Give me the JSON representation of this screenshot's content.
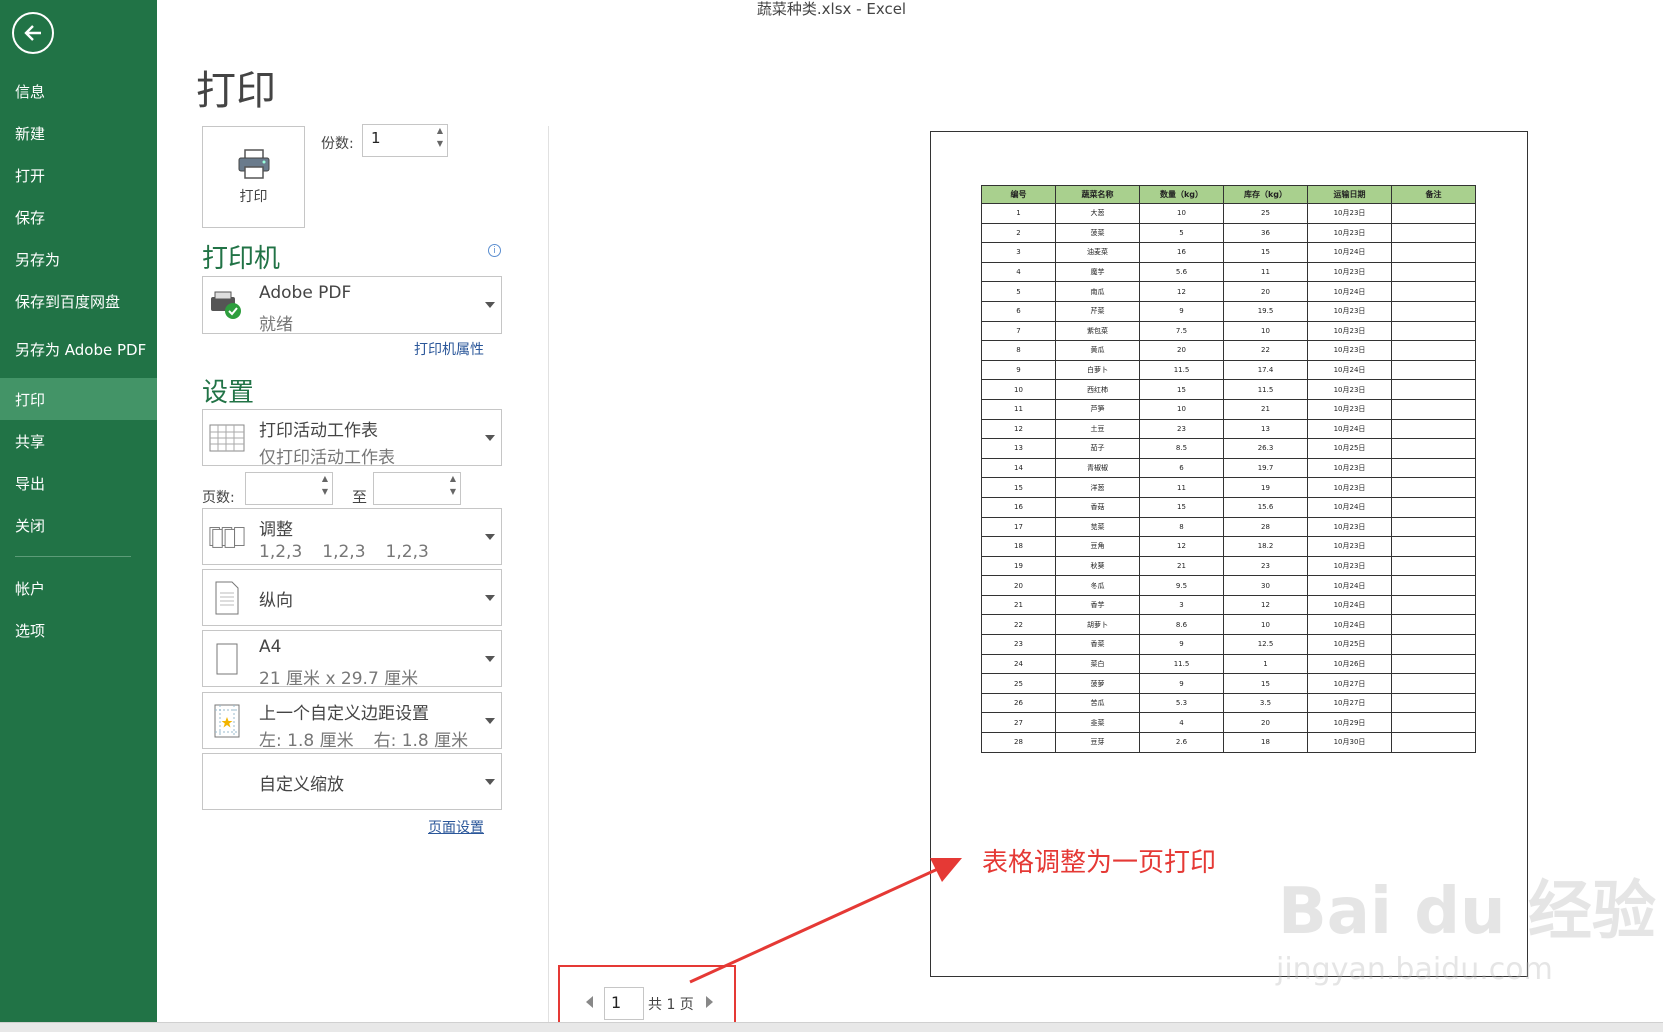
{
  "window_title": "蔬菜种类.xlsx - Excel",
  "sidebar": {
    "items": [
      {
        "label": "信息"
      },
      {
        "label": "新建"
      },
      {
        "label": "打开"
      },
      {
        "label": "保存"
      },
      {
        "label": "另存为"
      },
      {
        "label": "保存到百度网盘"
      },
      {
        "label": "另存为 Adobe PDF"
      },
      {
        "label": "打印",
        "active": true
      },
      {
        "label": "共享"
      },
      {
        "label": "导出"
      },
      {
        "label": "关闭"
      }
    ],
    "bottom_items": [
      {
        "label": "帐户"
      },
      {
        "label": "选项"
      }
    ]
  },
  "page_title": "打印",
  "print_button_label": "打印",
  "copies": {
    "label": "份数:",
    "value": "1"
  },
  "printer": {
    "heading": "打印机",
    "name": "Adobe PDF",
    "status": "就绪",
    "properties_link": "打印机属性"
  },
  "settings": {
    "heading": "设置",
    "scope": {
      "title": "打印活动工作表",
      "subtitle": "仅打印活动工作表"
    },
    "pages_label": "页数:",
    "to_label": "至",
    "collate": {
      "title": "调整",
      "subtitle_parts": [
        "1,2,3",
        "1,2,3",
        "1,2,3"
      ]
    },
    "orientation": {
      "title": "纵向"
    },
    "paper": {
      "title": "A4",
      "subtitle": "21 厘米 x 29.7 厘米"
    },
    "margins": {
      "title": "上一个自定义边距设置",
      "subtitle_left": "左:  1.8 厘米",
      "subtitle_right": "右:  1.8 厘米"
    },
    "scaling": {
      "title": "自定义缩放"
    },
    "page_setup_link": "页面设置"
  },
  "preview_table": {
    "headers": [
      "编号",
      "蔬菜名称",
      "数量（kg）",
      "库存（kg）",
      "运输日期",
      "备注"
    ],
    "rows": [
      [
        "1",
        "大葱",
        "10",
        "25",
        "10月23日",
        ""
      ],
      [
        "2",
        "菠菜",
        "5",
        "36",
        "10月23日",
        ""
      ],
      [
        "3",
        "油麦菜",
        "16",
        "15",
        "10月24日",
        ""
      ],
      [
        "4",
        "魔芋",
        "5.6",
        "11",
        "10月23日",
        ""
      ],
      [
        "5",
        "南瓜",
        "12",
        "20",
        "10月24日",
        ""
      ],
      [
        "6",
        "芹菜",
        "9",
        "19.5",
        "10月23日",
        ""
      ],
      [
        "7",
        "紫包菜",
        "7.5",
        "10",
        "10月23日",
        ""
      ],
      [
        "8",
        "黄瓜",
        "20",
        "22",
        "10月23日",
        ""
      ],
      [
        "9",
        "白萝卜",
        "11.5",
        "17.4",
        "10月24日",
        ""
      ],
      [
        "10",
        "西红柿",
        "15",
        "11.5",
        "10月23日",
        ""
      ],
      [
        "11",
        "芦笋",
        "10",
        "21",
        "10月23日",
        ""
      ],
      [
        "12",
        "土豆",
        "23",
        "13",
        "10月24日",
        ""
      ],
      [
        "13",
        "茄子",
        "8.5",
        "26.3",
        "10月25日",
        ""
      ],
      [
        "14",
        "青椒椒",
        "6",
        "19.7",
        "10月23日",
        ""
      ],
      [
        "15",
        "洋葱",
        "11",
        "19",
        "10月23日",
        ""
      ],
      [
        "16",
        "香菇",
        "15",
        "15.6",
        "10月24日",
        ""
      ],
      [
        "17",
        "苋菜",
        "8",
        "28",
        "10月23日",
        ""
      ],
      [
        "18",
        "豆角",
        "12",
        "18.2",
        "10月23日",
        ""
      ],
      [
        "19",
        "秋葵",
        "21",
        "23",
        "10月23日",
        ""
      ],
      [
        "20",
        "冬瓜",
        "9.5",
        "30",
        "10月24日",
        ""
      ],
      [
        "21",
        "香芋",
        "3",
        "12",
        "10月24日",
        ""
      ],
      [
        "22",
        "胡萝卜",
        "8.6",
        "10",
        "10月24日",
        ""
      ],
      [
        "23",
        "香菜",
        "9",
        "12.5",
        "10月25日",
        ""
      ],
      [
        "24",
        "菜白",
        "11.5",
        "1",
        "10月26日",
        ""
      ],
      [
        "25",
        "菠萝",
        "9",
        "15",
        "10月27日",
        ""
      ],
      [
        "26",
        "苦瓜",
        "5.3",
        "3.5",
        "10月27日",
        ""
      ],
      [
        "27",
        "韭菜",
        "4",
        "20",
        "10月29日",
        ""
      ],
      [
        "28",
        "豆芽",
        "2.6",
        "18",
        "10月30日",
        ""
      ]
    ]
  },
  "pager": {
    "current": "1",
    "total_label": "共 1 页"
  },
  "annotation": "表格调整为一页打印",
  "watermark": {
    "main": "Bai du 经验",
    "sub": "jingyan.baidu.com"
  },
  "colors": {
    "excel_green": "#217346",
    "active_nav": "#439467",
    "header_fill": "#a9d08e",
    "annotation_red": "#e53935"
  }
}
